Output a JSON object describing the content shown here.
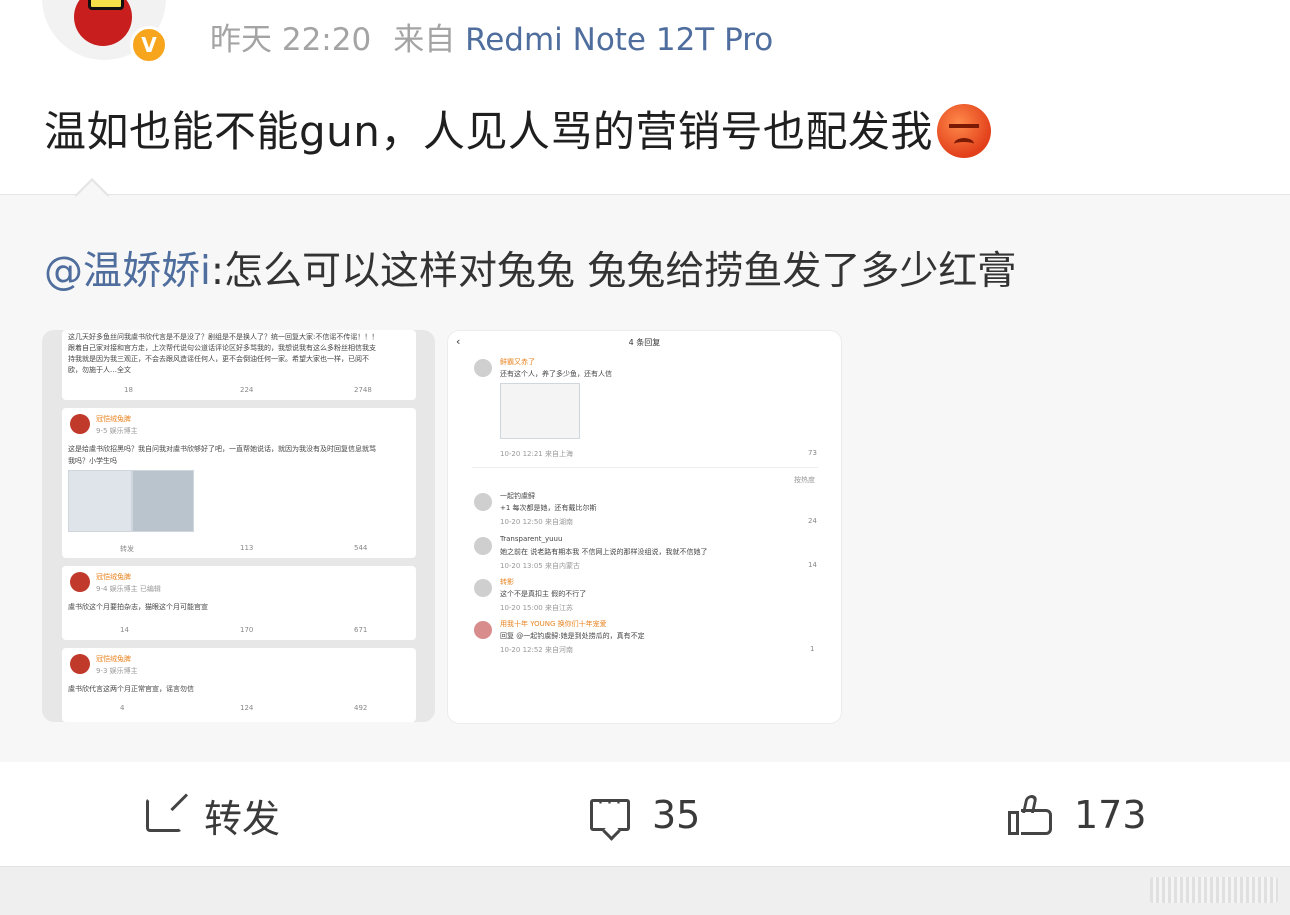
{
  "post": {
    "time": "昨天 22:20",
    "source_prefix": "来自",
    "device": "Redmi Note 12T Pro",
    "text": "温如也能不能gun，人见人骂的营销号也配发我",
    "emoji": "angry-face"
  },
  "repost": {
    "mention": "@温娇娇i",
    "text": ":怎么可以这样对兔兔  兔兔给捞鱼发了多少红膏"
  },
  "screenshot1": {
    "top_text_1": "这几天好多鱼丝问我虞书欣代言是不是没了？剧组是不是换人了？统一回复大家:不信谣不传谣！！！",
    "top_text_2": "跟着自己家对接和官方走，上次帮代说句公道话评论区好多骂我的，我想说我有这么多粉丝相信我支",
    "top_text_3": "持我就是因为我三观正，不会去跟风造谣任何人，更不会倒油任何一家。希望大家也一样，已阅不",
    "top_text_4": "欧，勿施于人…全文",
    "top_counts": [
      "18",
      "224",
      "2748"
    ],
    "cards": [
      {
        "user": "冠恺绒兔脾",
        "date": "9-5 娱乐博主",
        "text_1": "这是给虞书欣招黑吗？我自问我对虞书欣够好了吧，一直帮她说话，就因为我没有及时回复信息就骂",
        "text_2": "我吗？小学生吗",
        "counts": [
          "转发",
          "113",
          "544"
        ]
      },
      {
        "user": "冠恺绒兔脾",
        "date": "9-4 娱乐博主 已编辑",
        "text_1": "虞书欣这个月要拍杂志，猫眼这个月可能官宣",
        "counts": [
          "14",
          "170",
          "671"
        ]
      },
      {
        "user": "冠恺绒兔脾",
        "date": "9-3 娱乐博主",
        "text_1": "虞书欣代言这两个月正常官宣，谣言勿信",
        "counts": [
          "4",
          "124",
          "492"
        ]
      }
    ]
  },
  "screenshot2": {
    "title": "4 条回复",
    "back": "‹",
    "sort": "按热度",
    "comments": [
      {
        "user": "鲜霸又赤了",
        "text": "还有这个人，养了多少鱼，还有人信",
        "meta": "10-20 12:21 来自上海",
        "likes": "73"
      },
      {
        "user": "一起钓虞鲟",
        "text": "+1 每次都是她，还有戴比尔斯",
        "meta": "10-20 12:50 来自湖南",
        "likes": "24"
      },
      {
        "user": "Transparent_yuuu",
        "text": "她之前在 说老路有期本我 不信网上说的那样没组说，我就不信她了",
        "meta": "10-20 13:05 来自内蒙古",
        "likes": "14"
      },
      {
        "user": "转影",
        "text": "这个不是真扣主 假的不行了",
        "meta": "10-20 15:00 来自江苏",
        "likes": ""
      },
      {
        "user": "用我十年 YOUNG 换你们十年宠爱",
        "text": "回复 @一起钓虞鲟:她是到处捞瓜的，真有不定",
        "meta": "10-20 12:52 来自河南",
        "likes": "1"
      }
    ]
  },
  "actions": {
    "repost_label": "转发",
    "comments_count": "35",
    "likes_count": "173"
  },
  "colors": {
    "link": "#4f6e9e",
    "meta_grey": "#a4a4a4",
    "repost_bg": "#f7f7f7",
    "verified": "#f7a51d"
  }
}
